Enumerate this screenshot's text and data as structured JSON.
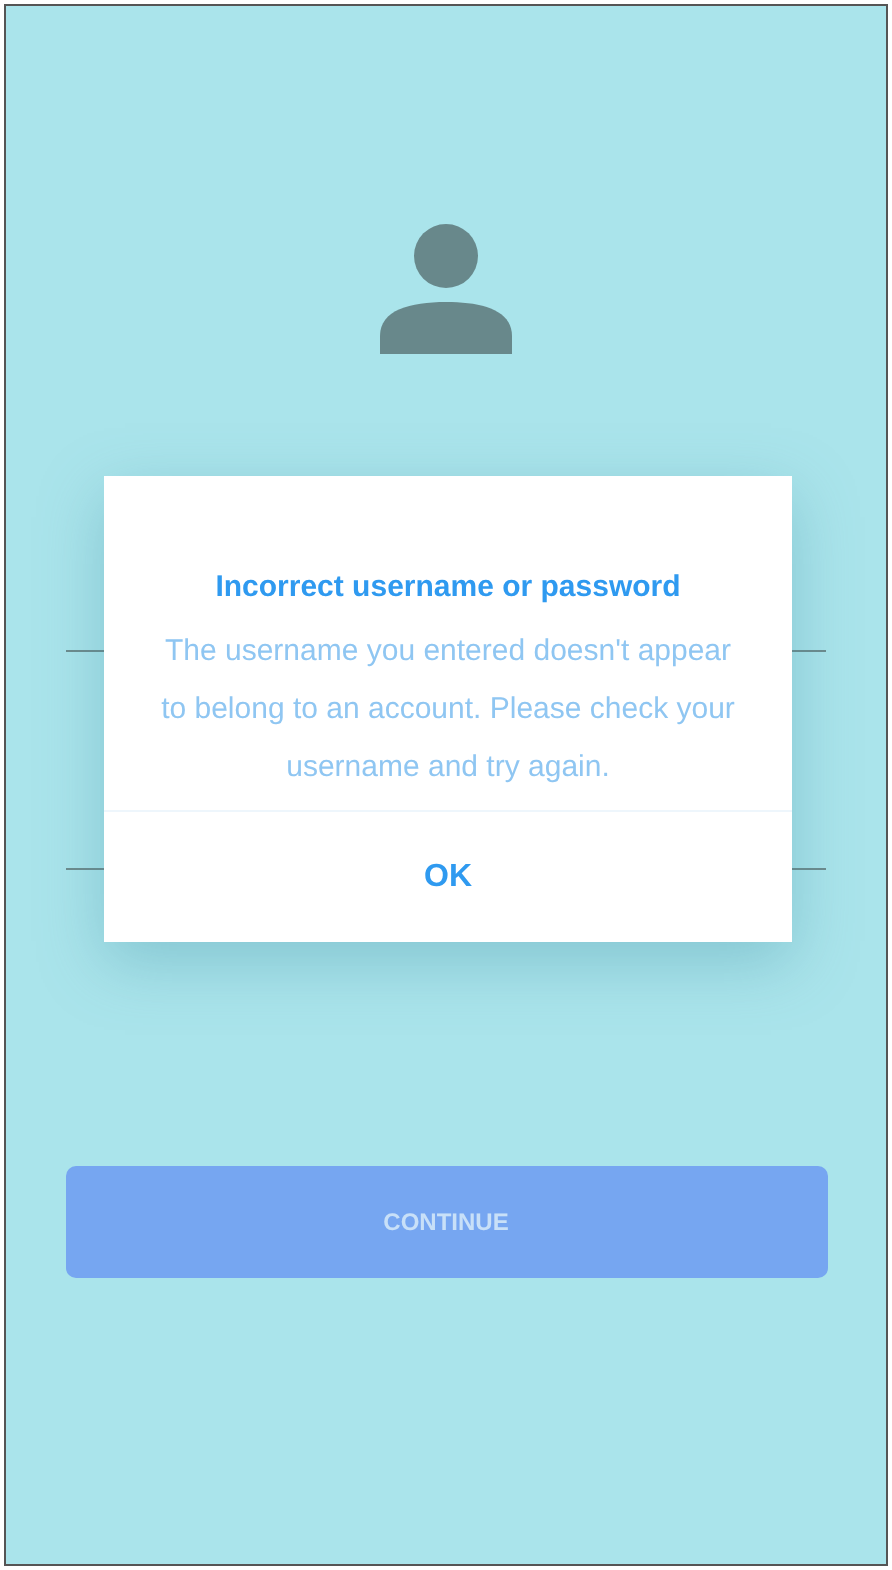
{
  "dialog": {
    "title": "Incorrect username or password",
    "message": "The username you entered doesn't appear to belong to an account. Please check your username and try again.",
    "button": "OK"
  },
  "continue_button": {
    "label": "CONTINUE",
    "disabled": true
  }
}
